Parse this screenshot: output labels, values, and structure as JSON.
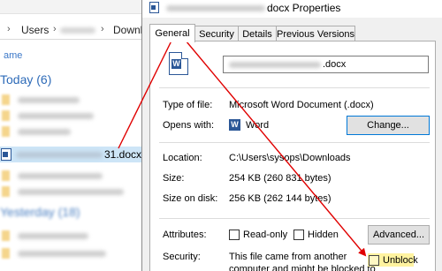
{
  "explorer": {
    "breadcrumb": [
      "Users",
      "Downl"
    ],
    "column_header": "ame",
    "group_today": "Today (6)",
    "group_yesterday": "Yesterday (18)",
    "selected_file_suffix": "31.docx",
    "file_icon": "word-document-icon"
  },
  "dialog": {
    "title_suffix": "docx Properties",
    "tabs": [
      "General",
      "Security",
      "Details",
      "Previous Versions"
    ],
    "active_tab": "General",
    "filename_suffix": ".docx",
    "fields": {
      "type_label": "Type of file:",
      "type_value": "Microsoft Word Document (.docx)",
      "opens_label": "Opens with:",
      "opens_value": "Word",
      "change_button": "Change...",
      "location_label": "Location:",
      "location_value": "C:\\Users\\sysops\\Downloads",
      "size_label": "Size:",
      "size_value": "254 KB (260 831 bytes)",
      "size_disk_label": "Size on disk:",
      "size_disk_value": "256 KB (262 144 bytes)",
      "attributes_label": "Attributes:",
      "readonly_label": "Read-only",
      "hidden_label": "Hidden",
      "advanced_button": "Advanced...",
      "security_label": "Security:",
      "security_text_1": "This file came from another",
      "security_text_2": "computer and might be blocked to",
      "unblock_label": "Unblock"
    }
  },
  "colors": {
    "word_blue": "#2b5797",
    "annotation_red": "#e00000",
    "selection": "#cde5f7",
    "highlight_yellow": "#fff3a0"
  }
}
